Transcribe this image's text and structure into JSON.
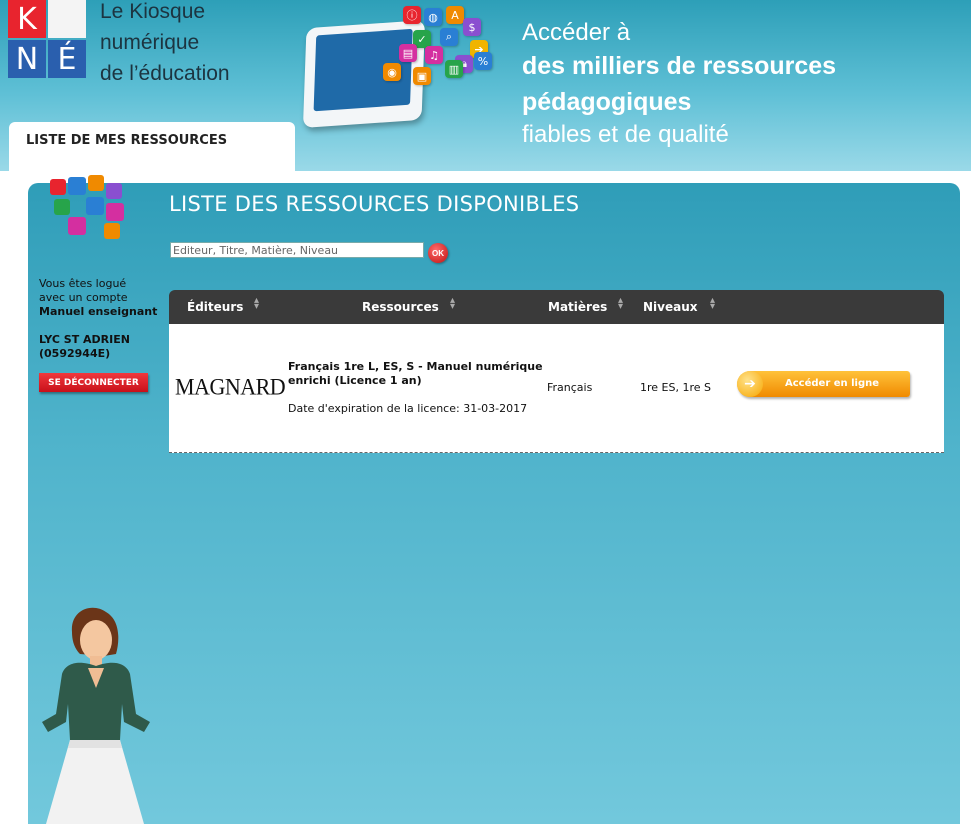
{
  "brand": {
    "letters": [
      "K",
      "N",
      "É"
    ],
    "logo_line1": "Le Kiosque",
    "logo_line2": "numérique",
    "logo_line3": "de l’éducation",
    "colors": {
      "k_cell": "#e8242e",
      "n_cell": "#2a5fae",
      "e_cell": "#2a5fae",
      "corner_cell": "#f4f4f4"
    }
  },
  "tagline": {
    "line1": "Accéder à",
    "line2": "des milliers de ressources pédagogiques",
    "line3": "fiables et de qualité"
  },
  "nav": {
    "tab_label": "LISTE DE MES RESSOURCES"
  },
  "page": {
    "title": "LISTE DES RESSOURCES DISPONIBLES"
  },
  "search": {
    "placeholder": "Editeur, Titre, Matière, Niveau",
    "value": "",
    "ok_label": "OK"
  },
  "user": {
    "line1": "Vous êtes logué",
    "line2": "avec un compte",
    "role": "Manuel enseignant",
    "school": "LYC ST ADRIEN",
    "code": "(0592944E)",
    "logout_label": "SE DÉCONNECTER"
  },
  "table": {
    "headers": [
      "Éditeurs",
      "Ressources",
      "Matières",
      "Niveaux"
    ],
    "rows": [
      {
        "publisher": "MAGNARD",
        "title": "Français 1re L, ES, S - Manuel numérique enrichi (Licence 1 an)",
        "expiry": "Date d'expiration de la licence: 31-03-2017",
        "subject": "Français",
        "levels": "1re ES, 1re S",
        "action_label": "Accéder en ligne"
      }
    ]
  },
  "theme": {
    "header_bg": "#4fb3cb",
    "panel_bg": "#3aa6c0",
    "table_header_bg": "#3a3a3a",
    "logout_red": "#e02028",
    "access_orange": "#f59a10",
    "ok_red": "#d61a1a"
  },
  "icons": [
    "info-icon",
    "globe-icon",
    "music-icon",
    "search-icon",
    "check-icon",
    "rss-icon",
    "lock-icon",
    "percent-icon",
    "arrow-right-icon",
    "sort-icon"
  ]
}
